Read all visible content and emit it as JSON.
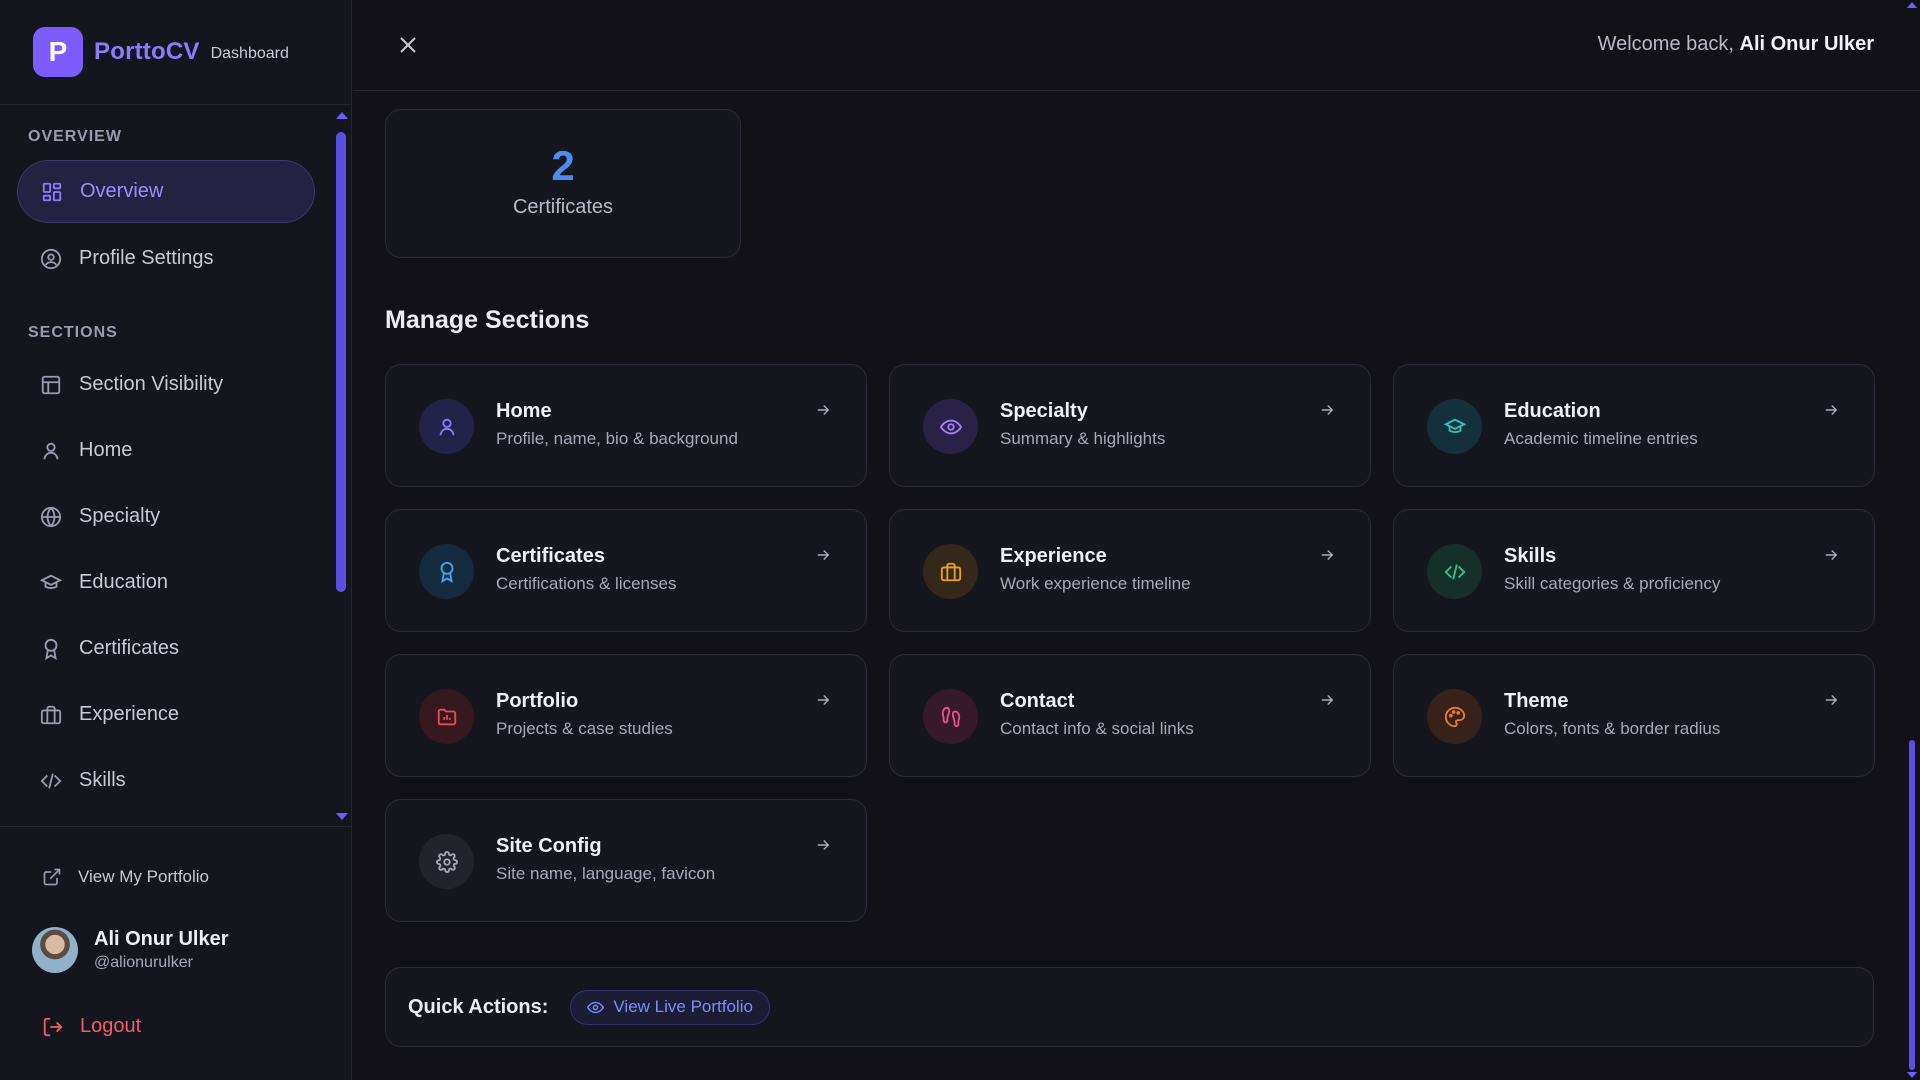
{
  "brand": {
    "logo_letter": "P",
    "name": "PorttoCV",
    "subtitle": "Dashboard",
    "accent": "#7c5cff"
  },
  "sidebar": {
    "overview_heading": "OVERVIEW",
    "overview_items": [
      {
        "label": "Overview",
        "icon": "grid-icon",
        "active": true
      },
      {
        "label": "Profile Settings",
        "icon": "user-circle-icon",
        "active": false
      }
    ],
    "sections_heading": "SECTIONS",
    "section_items": [
      {
        "label": "Section Visibility",
        "icon": "layout-icon"
      },
      {
        "label": "Home",
        "icon": "user-icon"
      },
      {
        "label": "Specialty",
        "icon": "globe-icon"
      },
      {
        "label": "Education",
        "icon": "graduation-cap-icon"
      },
      {
        "label": "Certificates",
        "icon": "award-icon"
      },
      {
        "label": "Experience",
        "icon": "briefcase-icon"
      },
      {
        "label": "Skills",
        "icon": "code-icon"
      }
    ],
    "view_portfolio": "View My Portfolio",
    "user": {
      "name": "Ali Onur Ulker",
      "handle": "@alionurulker"
    },
    "logout": "Logout"
  },
  "topbar": {
    "welcome_prefix": "Welcome back,",
    "welcome_name": "Ali Onur Ulker"
  },
  "stat": {
    "value": "2",
    "label": "Certificates"
  },
  "manage": {
    "title": "Manage Sections",
    "cards": [
      {
        "title": "Home",
        "desc": "Profile, name, bio & background",
        "icon": "user-icon",
        "color": "#8b7cff",
        "bg": "#22224a"
      },
      {
        "title": "Specialty",
        "desc": "Summary & highlights",
        "icon": "eye-icon",
        "color": "#a77cff",
        "bg": "#2a2246"
      },
      {
        "title": "Education",
        "desc": "Academic timeline entries",
        "icon": "graduation-cap-icon",
        "color": "#2cc6c0",
        "bg": "#14303a"
      },
      {
        "title": "Certificates",
        "desc": "Certifications & licenses",
        "icon": "award-icon",
        "color": "#3aa9f0",
        "bg": "#142a3e"
      },
      {
        "title": "Experience",
        "desc": "Work experience timeline",
        "icon": "briefcase-icon",
        "color": "#f0a020",
        "bg": "#33281a"
      },
      {
        "title": "Skills",
        "desc": "Skill categories & proficiency",
        "icon": "code-icon",
        "color": "#2ec98a",
        "bg": "#153028"
      },
      {
        "title": "Portfolio",
        "desc": "Projects & case studies",
        "icon": "folder-icon",
        "color": "#f04a5a",
        "bg": "#36181f"
      },
      {
        "title": "Contact",
        "desc": "Contact info & social links",
        "icon": "footprints-icon",
        "color": "#f0508a",
        "bg": "#361a2a"
      },
      {
        "title": "Theme",
        "desc": "Colors, fonts & border radius",
        "icon": "palette-icon",
        "color": "#f07a2a",
        "bg": "#36221a"
      },
      {
        "title": "Site Config",
        "desc": "Site name, language, favicon",
        "icon": "gear-icon",
        "color": "#a8a8b8",
        "bg": "#23232c"
      }
    ]
  },
  "quick_actions": {
    "label": "Quick Actions:",
    "button": "View Live Portfolio"
  }
}
